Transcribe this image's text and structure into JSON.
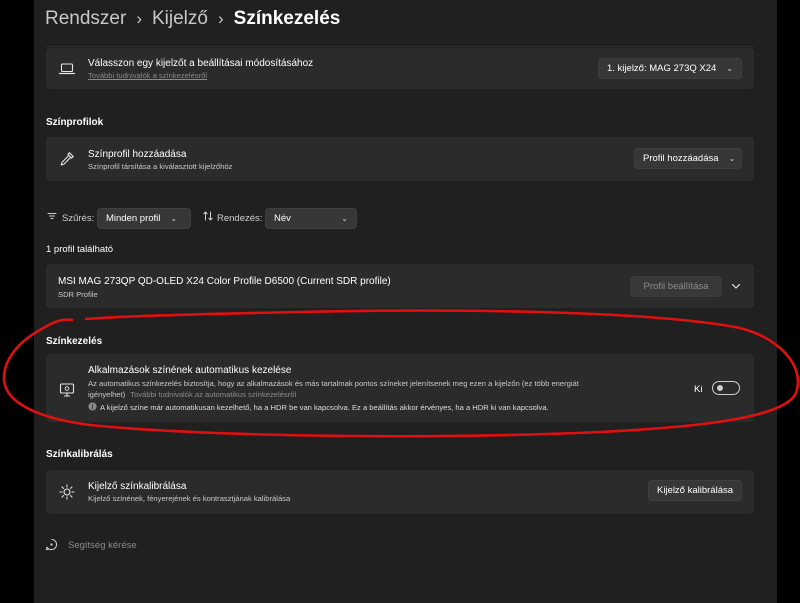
{
  "breadcrumb": {
    "items": [
      "Rendszer",
      "Kijelző",
      "Színkezelés"
    ],
    "separator": "›"
  },
  "display_select": {
    "title": "Válasszon egy kijelzőt a beállításai módosításához",
    "link": "További tudnivalók a színkezelésről",
    "dropdown_value": "1. kijelző: MAG 273Q X24"
  },
  "color_profiles": {
    "heading": "Színprofilok",
    "add": {
      "title": "Színprofil hozzáadása",
      "subtitle": "Színprofil társítása a kiválasztott kijelzőhöz",
      "button": "Profil hozzáadása"
    }
  },
  "filter": {
    "filter_label": "Szűrés:",
    "filter_value": "Minden profil",
    "sort_label": "Rendezés:",
    "sort_value": "Név"
  },
  "profile_count": "1 profil található",
  "profile": {
    "name": "MSI MAG 273QP QD-OLED X24 Color Profile D6500 (Current SDR profile)",
    "type": "SDR Profile",
    "button": "Profil beállítása"
  },
  "color_management": {
    "heading": "Színkezelés",
    "title": "Alkalmazások színének automatikus kezelése",
    "description_line1": "Az automatikus színkezelés biztosítja, hogy az alkalmazások és más tartalmak pontos színeket jelenítsenek meg ezen a kijelzőn (ez több energiát",
    "description_line2": "igényelhet)",
    "description_link": "További tudnivalók az automatikus színkezelésről",
    "info": "A kijelző színe már automatikusan kezelhető, ha a HDR be van kapcsolva. Ez a beállítás akkor érvényes, ha a HDR ki van kapcsolva.",
    "toggle_state": "Ki",
    "toggle_on": false
  },
  "calibration": {
    "heading": "Színkalibrálás",
    "title": "Kijelző színkalibrálása",
    "subtitle": "Kijelző színének, fényerejének és kontrasztjának kalibrálása",
    "button": "Kijelző kalibrálása"
  },
  "help": "Segítség kérése",
  "colors": {
    "background": "#202020",
    "card": "#2b2b2b",
    "annotation": "#e01010"
  }
}
